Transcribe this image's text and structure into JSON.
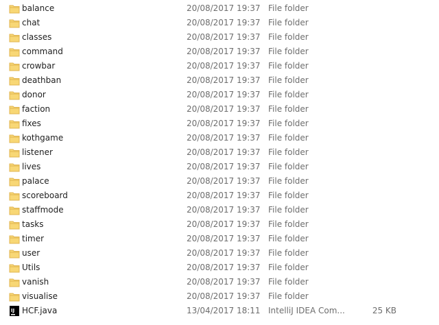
{
  "files": [
    {
      "name": "balance",
      "date": "20/08/2017 19:37",
      "type": "File folder",
      "size": "",
      "icon": "folder-icon"
    },
    {
      "name": "chat",
      "date": "20/08/2017 19:37",
      "type": "File folder",
      "size": "",
      "icon": "folder-icon"
    },
    {
      "name": "classes",
      "date": "20/08/2017 19:37",
      "type": "File folder",
      "size": "",
      "icon": "folder-icon"
    },
    {
      "name": "command",
      "date": "20/08/2017 19:37",
      "type": "File folder",
      "size": "",
      "icon": "folder-icon"
    },
    {
      "name": "crowbar",
      "date": "20/08/2017 19:37",
      "type": "File folder",
      "size": "",
      "icon": "folder-icon"
    },
    {
      "name": "deathban",
      "date": "20/08/2017 19:37",
      "type": "File folder",
      "size": "",
      "icon": "folder-icon"
    },
    {
      "name": "donor",
      "date": "20/08/2017 19:37",
      "type": "File folder",
      "size": "",
      "icon": "folder-icon"
    },
    {
      "name": "faction",
      "date": "20/08/2017 19:37",
      "type": "File folder",
      "size": "",
      "icon": "folder-icon"
    },
    {
      "name": "fixes",
      "date": "20/08/2017 19:37",
      "type": "File folder",
      "size": "",
      "icon": "folder-icon"
    },
    {
      "name": "kothgame",
      "date": "20/08/2017 19:37",
      "type": "File folder",
      "size": "",
      "icon": "folder-icon"
    },
    {
      "name": "listener",
      "date": "20/08/2017 19:37",
      "type": "File folder",
      "size": "",
      "icon": "folder-icon"
    },
    {
      "name": "lives",
      "date": "20/08/2017 19:37",
      "type": "File folder",
      "size": "",
      "icon": "folder-icon"
    },
    {
      "name": "palace",
      "date": "20/08/2017 19:37",
      "type": "File folder",
      "size": "",
      "icon": "folder-icon"
    },
    {
      "name": "scoreboard",
      "date": "20/08/2017 19:37",
      "type": "File folder",
      "size": "",
      "icon": "folder-icon"
    },
    {
      "name": "staffmode",
      "date": "20/08/2017 19:37",
      "type": "File folder",
      "size": "",
      "icon": "folder-icon"
    },
    {
      "name": "tasks",
      "date": "20/08/2017 19:37",
      "type": "File folder",
      "size": "",
      "icon": "folder-icon"
    },
    {
      "name": "timer",
      "date": "20/08/2017 19:37",
      "type": "File folder",
      "size": "",
      "icon": "folder-icon"
    },
    {
      "name": "user",
      "date": "20/08/2017 19:37",
      "type": "File folder",
      "size": "",
      "icon": "folder-icon"
    },
    {
      "name": "Utils",
      "date": "20/08/2017 19:37",
      "type": "File folder",
      "size": "",
      "icon": "folder-icon"
    },
    {
      "name": "vanish",
      "date": "20/08/2017 19:37",
      "type": "File folder",
      "size": "",
      "icon": "folder-icon"
    },
    {
      "name": "visualise",
      "date": "20/08/2017 19:37",
      "type": "File folder",
      "size": "",
      "icon": "folder-icon"
    },
    {
      "name": "HCF.java",
      "date": "13/04/2017 18:11",
      "type": "IntelliJ IDEA Com...",
      "size": "25 KB",
      "icon": "intellij-file-icon",
      "icon_text": "IJ"
    }
  ],
  "colors": {
    "folder_body": "#f8d775",
    "folder_tab": "#e0b450",
    "intellij_bg": "#000000",
    "intellij_fg": "#ffffff",
    "meta_text": "#6d6d6d"
  }
}
